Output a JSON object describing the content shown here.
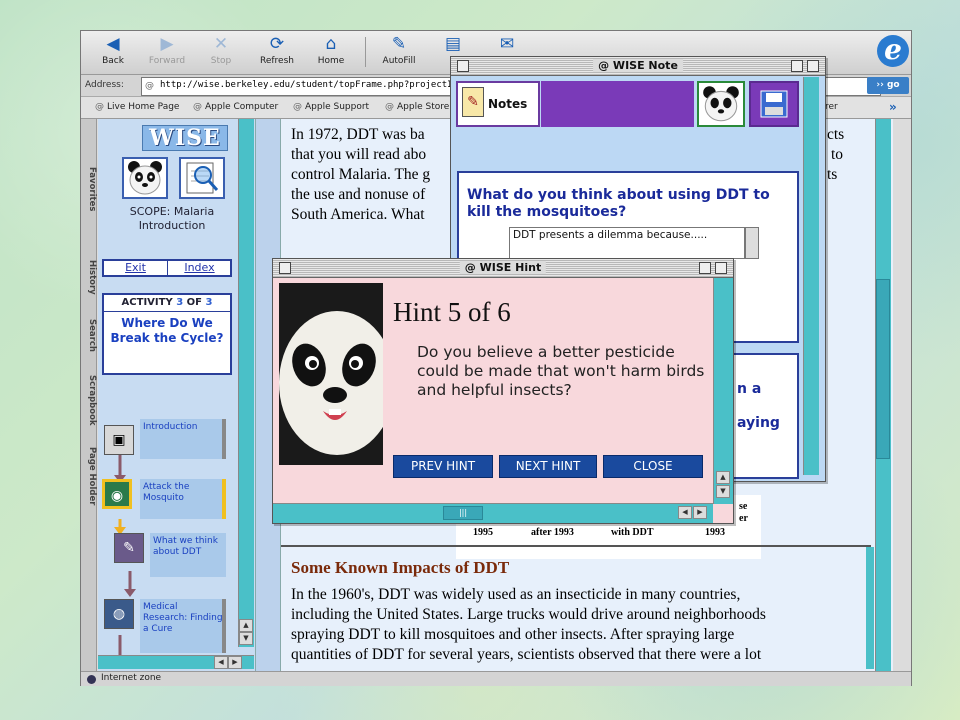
{
  "toolbar": {
    "buttons": [
      {
        "label": "Back",
        "icon": "back-arrow-icon",
        "glyph": "◀"
      },
      {
        "label": "Forward",
        "icon": "forward-arrow-icon",
        "glyph": "▶"
      },
      {
        "label": "Stop",
        "icon": "stop-icon",
        "glyph": "✕"
      },
      {
        "label": "Refresh",
        "icon": "refresh-icon",
        "glyph": "⟳"
      },
      {
        "label": "Home",
        "icon": "home-icon",
        "glyph": "⌂"
      },
      {
        "label": "AutoFill",
        "icon": "autofill-icon",
        "glyph": "✎"
      },
      {
        "label": "P",
        "icon": "print-icon",
        "glyph": "▤"
      },
      {
        "label": "",
        "icon": "mail-icon",
        "glyph": "✉"
      }
    ]
  },
  "address": {
    "label": "Address:",
    "url": "http://wise.berkeley.edu/student/topFrame.php?projectID=443",
    "go_label": "go"
  },
  "favorites": [
    "Live Home Page",
    "Apple Computer",
    "Apple Support",
    "Apple Store",
    "rer"
  ],
  "side_tabs": [
    "Favorites",
    "History",
    "Search",
    "Scrapbook",
    "Page Holder"
  ],
  "status": {
    "text": "Internet zone"
  },
  "left_frame": {
    "logo": "WISE",
    "scope_line1": "SCOPE: Malaria",
    "scope_line2": "Introduction",
    "exit_label": "Exit",
    "index_label": "Index",
    "activity_prefix": "ACTIVITY",
    "activity_num": "3",
    "activity_of": "OF",
    "activity_total": "3",
    "activity_title": "Where Do We Break the Cycle?",
    "steps": [
      "Introduction",
      "Attack the Mosquito",
      "What we think about DDT",
      "Medical Research: Finding a Cure"
    ]
  },
  "right_frame": {
    "para1_lines": [
      "In 1972, DDT was ba",
      "that you will read abo",
      "control Malaria. The g",
      "the use and nonuse of",
      "South America. What"
    ],
    "para1_right": [
      "cts",
      "to",
      "ts"
    ],
    "chart_labels": [
      "1995",
      "after 1993",
      "with DDT",
      "1993"
    ],
    "chart_side": [
      "se",
      "er"
    ],
    "heading": "Some Known Impacts of DDT",
    "para2_lines": [
      "In the 1960's, DDT was widely used as an insecticide in many countries,",
      "including the United States. Large trucks would drive around neighborhoods",
      "spraying DDT to kill mosquitoes and other insects. After spraying large",
      "quantities of DDT for several years, scientists observed that there were a lot"
    ]
  },
  "note_window": {
    "title": "WISE Note",
    "notes_label": "Notes",
    "question": "What do you think about using DDT to kill the mosquitoes?",
    "answer": "DDT presents a dilemma because.....",
    "fragment1": "n a",
    "fragment2": "aying"
  },
  "hint_window": {
    "title": "WISE Hint",
    "heading": "Hint 5 of 6",
    "body": "Do you believe a better pesticide could be made that won't harm birds and helpful insects?",
    "prev_label": "PREV HINT",
    "next_label": "NEXT HINT",
    "close_label": "CLOSE"
  }
}
